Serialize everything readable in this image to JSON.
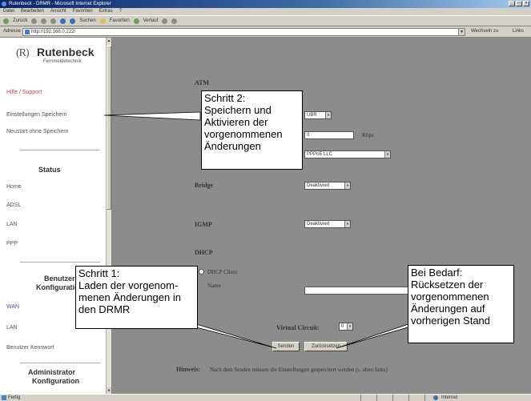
{
  "window": {
    "title": "Rutenbeck - DRMR - Microsoft Internet Explorer"
  },
  "menubar": [
    "Datei",
    "Bearbeiten",
    "Ansicht",
    "Favoriten",
    "Extras",
    "?"
  ],
  "toolbar": {
    "back": "Zurück",
    "search": "Suchen",
    "favorites": "Favoriten",
    "history": "Verlauf"
  },
  "address": {
    "label": "Adresse",
    "url": "http://192.168.0.222/",
    "go": "Wechseln zu",
    "links": "Links"
  },
  "sidebar": {
    "logo_name": "Rutenbeck",
    "logo_sub": "Fernmeldetechnik",
    "help": "Hilfe / Support",
    "save": "Einstellungen Speichern",
    "restart": "Neustart ohne Speichern",
    "status_head": "Status",
    "status_items": [
      "Home",
      "ADSL",
      "LAN",
      "PPP"
    ],
    "user_head_1": "Benutzer",
    "user_head_2": "Konfiguration",
    "user_items": [
      "WAN",
      "LAN",
      "Benutzer Kennwort"
    ],
    "admin_head_1": "Administrator",
    "admin_head_2": "Konfiguration"
  },
  "main": {
    "atm_label": "ATM",
    "encap_value": "UBR",
    "rate_value": "0",
    "rate_unit": "Kbps",
    "protocol_value": "PPPoE LLC",
    "bridge_label": "Bridge",
    "bridge_value": "Deaktiviert",
    "igmp_label": "IGMP",
    "igmp_value": "Deaktiviert",
    "dhcp_label": "DHCP",
    "dhcp_client": "DHCP Client",
    "name_label": "Name",
    "virtual_circuit_label": "Virtual Circuit:",
    "virtual_circuit_value": "0",
    "send_button": "Senden",
    "reset_button": "Zurücksetzen",
    "hint_label": "Hinweis:",
    "hint_text": "Nach dem Senden müssen die Einstellungen gespeichert werden (s. oben links)"
  },
  "statusbar": {
    "status": "Fertig",
    "zone": "Internet"
  },
  "callouts": {
    "step2": "Schritt 2:\nSpeichern und\nAktivieren der\nvorgenommenen\nÄnderungen",
    "step1": "Schritt 1:\nLaden der vorgenom-\nmenen Änderungen in\nden DRMR",
    "reset": "Bei Bedarf:\nRücksetzen der\nvorgenommenen\nÄnderungen auf\nvorherigen Stand"
  },
  "colors": {
    "main_bg": "#8c8c8c",
    "link_red": "#d04040",
    "link_blue": "#4050c0"
  }
}
